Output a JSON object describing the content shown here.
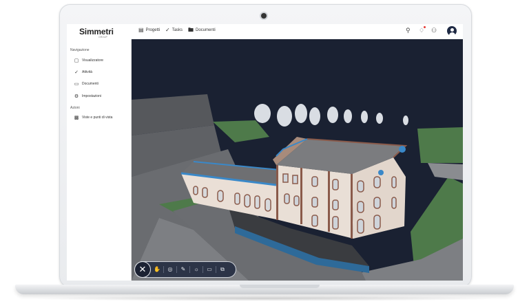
{
  "header": {
    "logo": "Simmetri",
    "logo_sub": "GROUP",
    "nav": [
      {
        "label": "Progetti",
        "icon": "briefcase-icon"
      },
      {
        "label": "Tasks",
        "icon": "check-icon"
      },
      {
        "label": "Documenti",
        "icon": "folder-icon"
      }
    ],
    "right_icons": [
      "search-icon",
      "bell-icon",
      "users-icon",
      "avatar-icon"
    ]
  },
  "sidebar": {
    "section1": "Navigazione",
    "items": [
      {
        "label": "Visualizzatore",
        "icon": "cube-icon"
      },
      {
        "label": "Attività",
        "icon": "check-icon"
      },
      {
        "label": "Documenti",
        "icon": "folder-icon"
      },
      {
        "label": "Impostazioni",
        "icon": "gear-icon"
      }
    ],
    "section2": "Azioni",
    "actions": [
      {
        "label": "Viste e punti di vista",
        "icon": "image-icon"
      }
    ]
  },
  "toolbar": {
    "tools": [
      "close-icon",
      "hand-icon",
      "eye-off-icon",
      "measure-icon",
      "sun-icon",
      "book-icon",
      "layers-icon"
    ]
  },
  "colors": {
    "viewport_bg": "#1a2132",
    "facade": "#e9dfd6",
    "trim": "#8a5a4a",
    "accent_blue": "#3a88c8",
    "grass": "#4e7a4a"
  }
}
